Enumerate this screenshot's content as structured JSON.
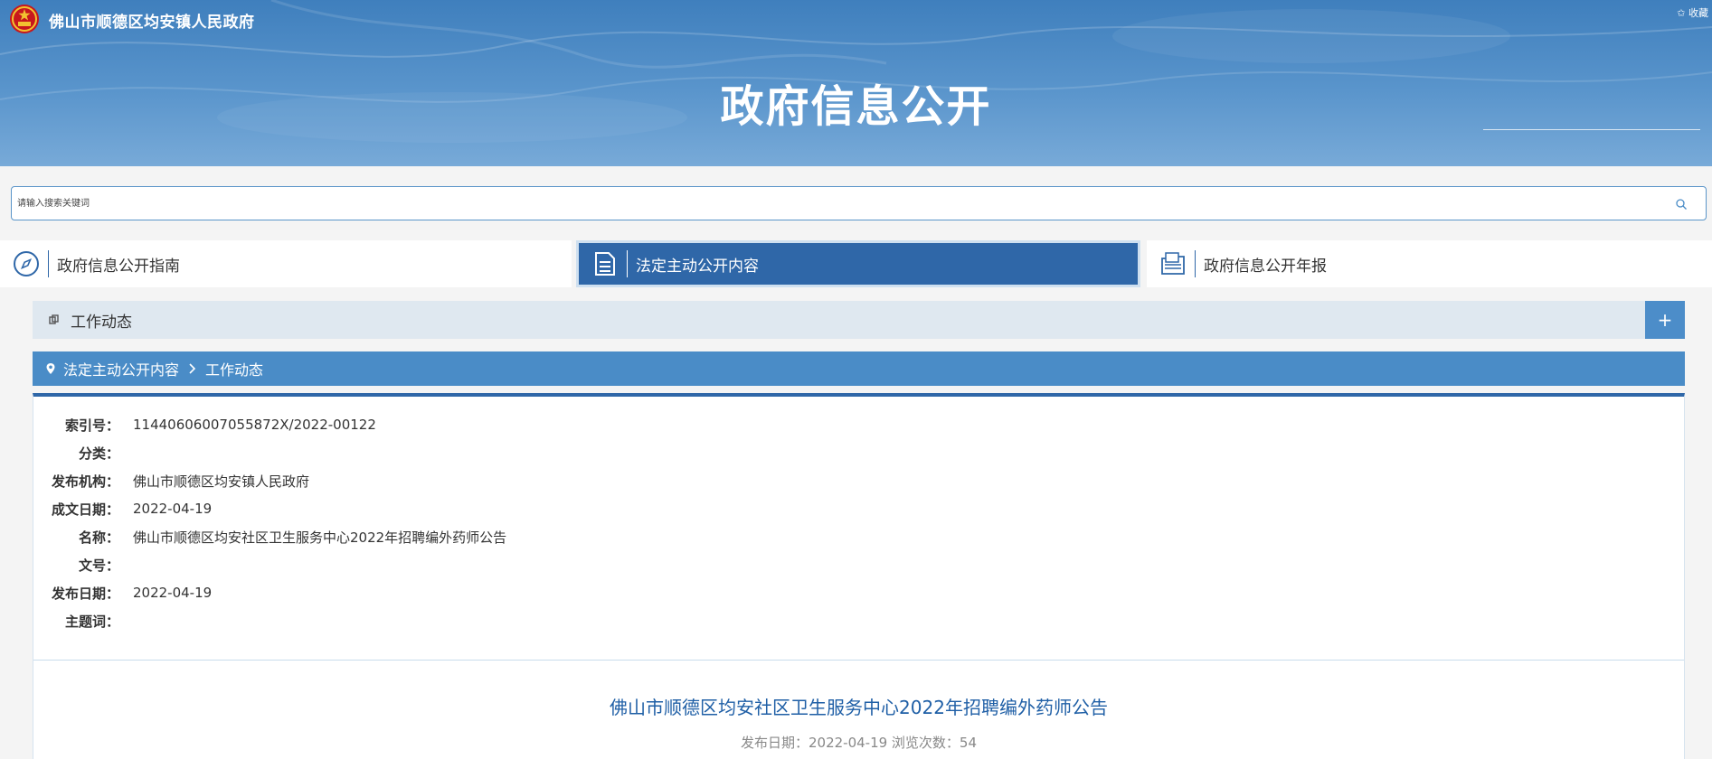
{
  "header": {
    "site_name": "佛山市顺德区均安镇人民政府",
    "favorite": "✩ 收藏",
    "title": "政府信息公开"
  },
  "search": {
    "placeholder": "请输入搜索关键词"
  },
  "tabs": [
    {
      "label": "政府信息公开指南",
      "icon": "compass-icon",
      "active": false
    },
    {
      "label": "法定主动公开内容",
      "icon": "document-icon",
      "active": true
    },
    {
      "label": "政府信息公开年报",
      "icon": "folder-report-icon",
      "active": false
    }
  ],
  "section": {
    "label": "工作动态",
    "expand": "+"
  },
  "breadcrumb": {
    "items": [
      "法定主动公开内容",
      "工作动态"
    ]
  },
  "meta": {
    "rows": [
      {
        "label": "索引号：",
        "value": "11440606007055872X/2022-00122"
      },
      {
        "label": "分类：",
        "value": ""
      },
      {
        "label": "发布机构：",
        "value": "佛山市顺德区均安镇人民政府"
      },
      {
        "label": "成文日期：",
        "value": "2022-04-19"
      },
      {
        "label": "名称：",
        "value": "佛山市顺德区均安社区卫生服务中心2022年招聘编外药师公告"
      },
      {
        "label": "文号：",
        "value": ""
      },
      {
        "label": "发布日期：",
        "value": "2022-04-19"
      },
      {
        "label": "主题词：",
        "value": ""
      }
    ]
  },
  "document": {
    "title": "佛山市顺德区均安社区卫生服务中心2022年招聘编外药师公告",
    "info": "发布日期：2022-04-19   浏览次数：54"
  },
  "colors": {
    "primary": "#2f67a8",
    "accent": "#4a8cc7",
    "section_bg": "#dfe8f0",
    "title_blue": "#1f5fa6"
  }
}
